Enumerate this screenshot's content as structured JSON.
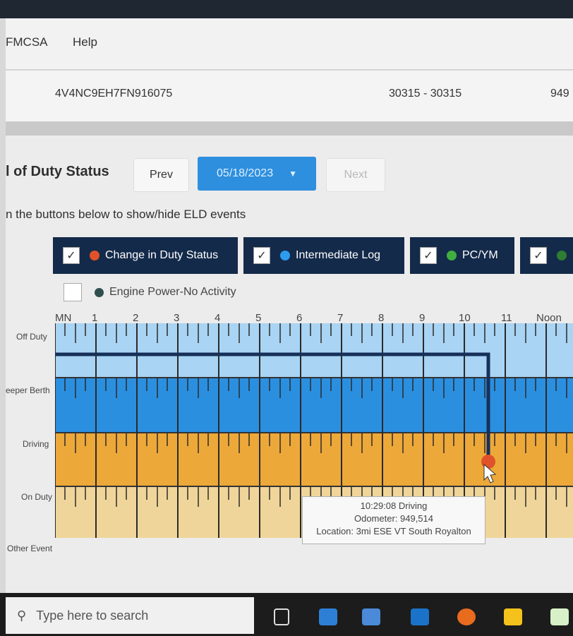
{
  "menu": {
    "items": [
      "FMCSA",
      "Help"
    ]
  },
  "vehicle": {
    "vin": "4V4NC9EH7FN916075",
    "range": "30315 - 30315",
    "odometer_partial": "949"
  },
  "rods": {
    "title": "l of Duty Status",
    "prev_label": "Prev",
    "date": "05/18/2023",
    "next_label": "Next",
    "hint": "n the buttons below to show/hide ELD events"
  },
  "filters": [
    {
      "label": "Change in Duty Status",
      "checked": true,
      "color": "#e0522a"
    },
    {
      "label": "Intermediate Log",
      "checked": true,
      "color": "#2d9cf0"
    },
    {
      "label": "PC/YM",
      "checked": true,
      "color": "#3fae3f"
    },
    {
      "label": "",
      "checked": true,
      "color": "#2e7d32"
    }
  ],
  "engine_filter": {
    "label": "Engine Power-No Activity",
    "checked": false,
    "color": "#2f4f4f"
  },
  "grid": {
    "hours": [
      "MN",
      "1",
      "2",
      "3",
      "4",
      "5",
      "6",
      "7",
      "8",
      "9",
      "10",
      "11",
      "Noon"
    ],
    "rows": [
      "Off Duty",
      "eeper Berth",
      "Driving",
      "On Duty",
      "Other Event"
    ],
    "colors": {
      "off_duty": "#a9d4f3",
      "sleeper": "#2b8fe0",
      "driving": "#eda83a",
      "on_duty": "#f0d59a",
      "line": "#16305a",
      "event": "#e0522a"
    }
  },
  "tooltip": {
    "time": "10:29:08 Driving",
    "odometer": "Odometer: 949,514",
    "location": "Location: 3mi ESE VT South Royalton"
  },
  "taskbar": {
    "search_placeholder": "Type here to search"
  }
}
